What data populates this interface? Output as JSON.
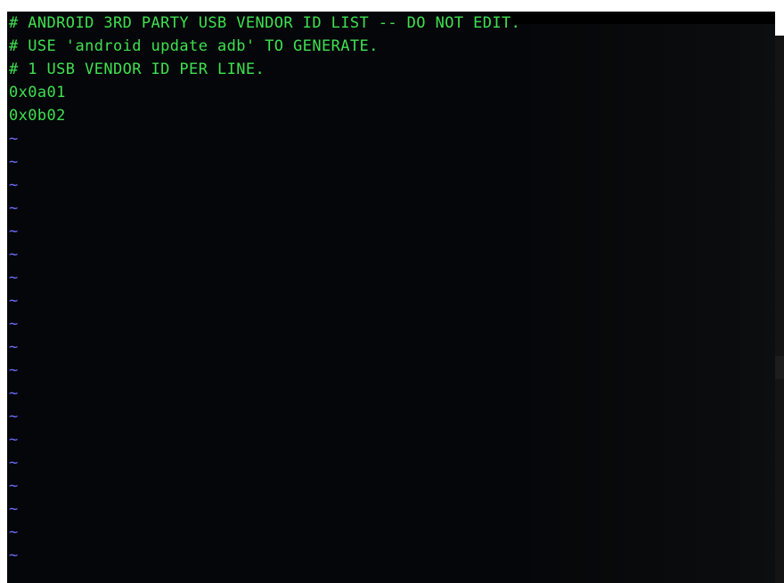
{
  "editor": {
    "lines": [
      "# ANDROID 3RD PARTY USB VENDOR ID LIST -- DO NOT EDIT.",
      "# USE 'android update adb' TO GENERATE.",
      "# 1 USB VENDOR ID PER LINE.",
      "0x0a01",
      "0x0b02"
    ],
    "empty_line_marker": "~",
    "empty_line_count": 19
  },
  "colors": {
    "editor_background": "#040609",
    "text": "#3fe04f",
    "empty_line_marker": "#6b6cff"
  }
}
